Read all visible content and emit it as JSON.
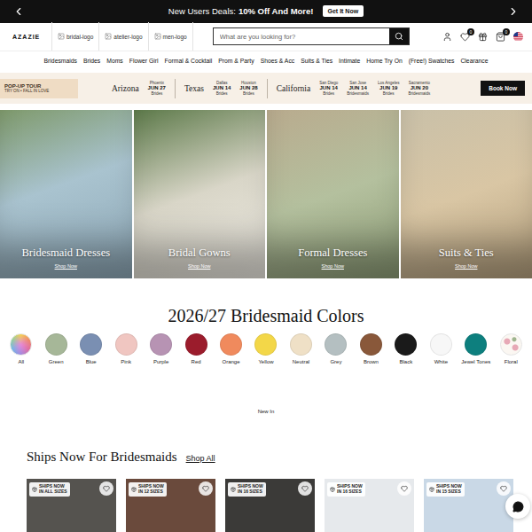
{
  "announcement": {
    "prefix": "New Users Deals:",
    "highlight": "10% Off And More!",
    "button": "Get It Now"
  },
  "header": {
    "logo": "AZAZIE",
    "brand_tabs": [
      "bridal-logo",
      "atelier-logo",
      "men-logo"
    ],
    "search": {
      "placeholder": "What are you looking for?"
    },
    "badges": {
      "wishlist": "0",
      "cart": "0"
    }
  },
  "nav": [
    "Bridesmaids",
    "Brides",
    "Moms",
    "Flower Girl",
    "Formal & Cocktail",
    "Prom & Party",
    "Shoes & Acc",
    "Suits & Ties",
    "Intimate",
    "Home Try On",
    "(Free!) Swatches",
    "Clearance"
  ],
  "popup_tour": {
    "title": "POP-UP TOUR",
    "subtitle": "TRY ON • FALL IN LOVE",
    "states": [
      {
        "name": "Arizona",
        "events": [
          {
            "city": "Phoenix",
            "date": "JUN 27",
            "type": "Brides"
          }
        ]
      },
      {
        "name": "Texas",
        "events": [
          {
            "city": "Dallas",
            "date": "JUN 14",
            "type": "Brides"
          },
          {
            "city": "Houston",
            "date": "JUN 28",
            "type": "Brides"
          }
        ]
      },
      {
        "name": "California",
        "events": [
          {
            "city": "San Diego",
            "date": "JUN 14",
            "type": "Brides"
          },
          {
            "city": "San Jose",
            "date": "JUN 14",
            "type": "Bridesmaids"
          },
          {
            "city": "Los Angeles",
            "date": "JUN 19",
            "type": "Brides"
          },
          {
            "city": "Sacramento",
            "date": "JUN 20",
            "type": "Bridesmaids"
          }
        ]
      }
    ],
    "button": "Book Now"
  },
  "hero": [
    {
      "title": "Bridesmaid Dresses",
      "link": "Shop Now"
    },
    {
      "title": "Bridal Gowns",
      "link": "Shop Now"
    },
    {
      "title": "Formal Dresses",
      "link": "Shop Now"
    },
    {
      "title": "Suits & Ties",
      "link": "Shop Now"
    }
  ],
  "colors": {
    "title": "2026/27 Bridesmaid Colors",
    "items": [
      {
        "label": "All",
        "kind": "gradient",
        "color": "#e58ad8"
      },
      {
        "label": "Green",
        "kind": "solid",
        "color": "#a6b798"
      },
      {
        "label": "Blue",
        "kind": "solid",
        "color": "#7a8fb2"
      },
      {
        "label": "Pink",
        "kind": "solid",
        "color": "#f0c6c1"
      },
      {
        "label": "Purple",
        "kind": "solid",
        "color": "#b793b3"
      },
      {
        "label": "Red",
        "kind": "solid",
        "color": "#9b1c2c"
      },
      {
        "label": "Orange",
        "kind": "solid",
        "color": "#f08a5d"
      },
      {
        "label": "Yellow",
        "kind": "solid",
        "color": "#f3d748"
      },
      {
        "label": "Neutral",
        "kind": "solid",
        "color": "#efe0c6"
      },
      {
        "label": "Grey",
        "kind": "solid",
        "color": "#b4bfc1"
      },
      {
        "label": "Brown",
        "kind": "solid",
        "color": "#89583a"
      },
      {
        "label": "Black",
        "kind": "solid",
        "color": "#1a1a1a"
      },
      {
        "label": "White",
        "kind": "solid",
        "color": "#f7f7f7"
      },
      {
        "label": "Jewel Tones",
        "kind": "solid",
        "color": "#0d7f7e"
      },
      {
        "label": "Floral",
        "kind": "pattern",
        "color": "#e7a9b6"
      }
    ]
  },
  "new_in": "New In",
  "ships_now": {
    "title": "Ships Now For Bridesmaids",
    "link": "Shop All",
    "cards": [
      {
        "line1": "SHIPS NOW",
        "line2": "IN ALL SIZES"
      },
      {
        "line1": "SHIPS NOW",
        "line2": "IN 12 SIZES"
      },
      {
        "line1": "SHIPS NOW",
        "line2": "IN 16 SIZES"
      },
      {
        "line1": "SHIPS NOW",
        "line2": "IN 16 SIZES"
      },
      {
        "line1": "SHIPS NOW",
        "line2": "IN 15 SIZES"
      }
    ]
  }
}
